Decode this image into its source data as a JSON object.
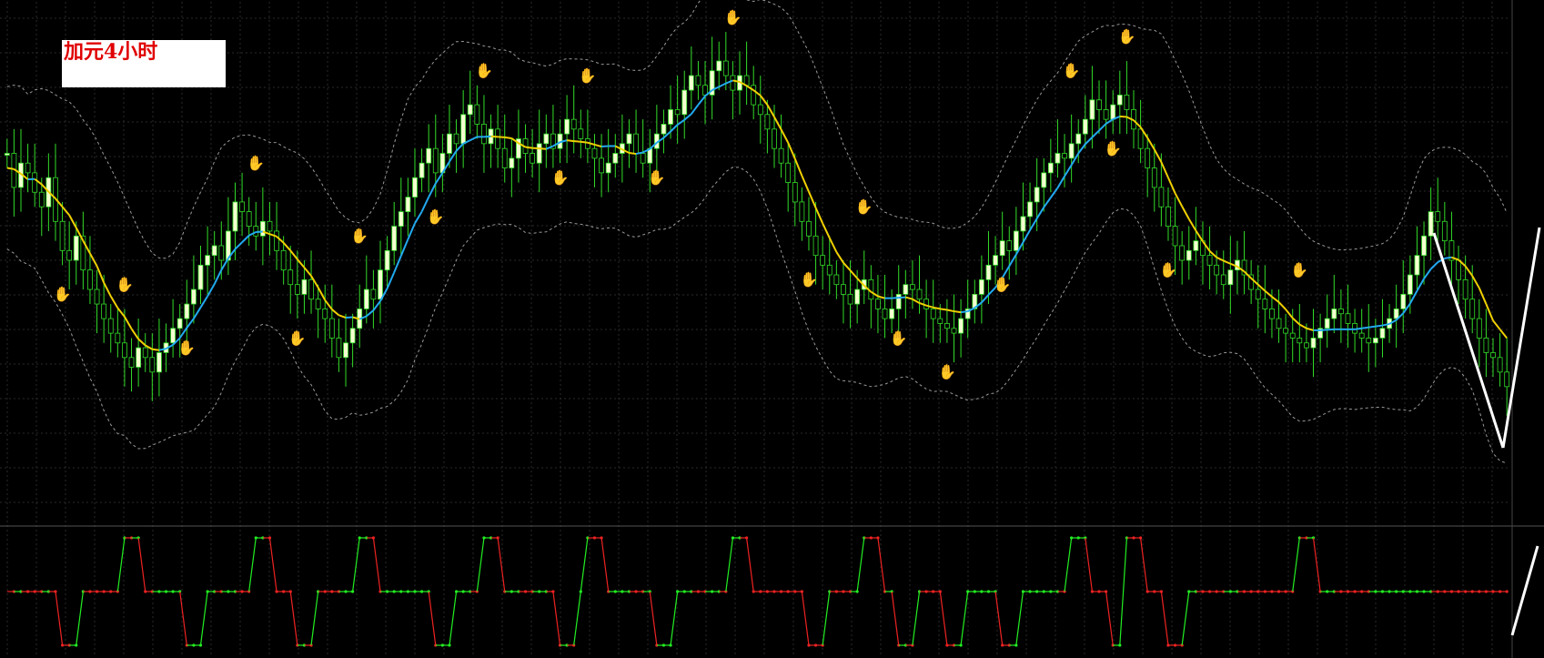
{
  "chart_label": "加元4小时",
  "colors": {
    "background": "#000000",
    "candle_body": "#f4ffd0",
    "candle_wick": "#32dc28",
    "ma_up": "#22aaf0",
    "ma_down": "#f0d000",
    "band": "#9a9a9a",
    "grid": "#2a2a2a",
    "osc_up": "#22ee22",
    "osc_down": "#ee2222",
    "fractal_top": "#ee2222",
    "fractal_bottom": "#3399ff",
    "annotation": "#ffffff"
  },
  "chart_data": {
    "type": "candlestick",
    "grid": true,
    "ylim": [
      0,
      100
    ],
    "closes": [
      72,
      65,
      70,
      68,
      64,
      61,
      67,
      58,
      52,
      50,
      55,
      48,
      44,
      41,
      38,
      35,
      33,
      30,
      28,
      32,
      30,
      27,
      31,
      33,
      36,
      38,
      41,
      44,
      49,
      51,
      53,
      50,
      56,
      62,
      60,
      57,
      55,
      58,
      56,
      52,
      48,
      45,
      43,
      46,
      42,
      40,
      38,
      34,
      30,
      33,
      36,
      40,
      44,
      42,
      48,
      52,
      57,
      60,
      63,
      67,
      70,
      73,
      68,
      72,
      76,
      74,
      80,
      82,
      78,
      74,
      77,
      73,
      69,
      71,
      75,
      72,
      70,
      74,
      76,
      73,
      76,
      79,
      77,
      75,
      73,
      71,
      68,
      70,
      72,
      74,
      76,
      72,
      70,
      73,
      76,
      78,
      81,
      80,
      85,
      88,
      86,
      84,
      89,
      91,
      88,
      85,
      88,
      86,
      82,
      80,
      77,
      73,
      70,
      66,
      62,
      58,
      55,
      51,
      49,
      47,
      45,
      43,
      41,
      44,
      46,
      42,
      40,
      38,
      40,
      43,
      45,
      44,
      42,
      40,
      38,
      37,
      36,
      35,
      38,
      40,
      43,
      46,
      49,
      51,
      54,
      52,
      56,
      59,
      62,
      65,
      68,
      70,
      72,
      71,
      74,
      76,
      79,
      83,
      81,
      79,
      82,
      84,
      81,
      77,
      73,
      69,
      65,
      61,
      57,
      53,
      50,
      52,
      54,
      51,
      49,
      47,
      45,
      48,
      50,
      47,
      44,
      42,
      40,
      38,
      36,
      35,
      34,
      33,
      32,
      34,
      36,
      38,
      40,
      39,
      37,
      35,
      34,
      33,
      34,
      36,
      38,
      40,
      43,
      47,
      51,
      55,
      60,
      58,
      54,
      50,
      46,
      42,
      38,
      34,
      31,
      30,
      27,
      24
    ],
    "ma_color_switch": "slope",
    "fractal_tops": [
      17,
      36,
      51,
      69,
      84,
      105,
      124,
      154,
      162,
      187
    ],
    "fractal_bottoms": [
      8,
      26,
      42,
      62,
      80,
      94,
      116,
      129,
      136,
      144,
      160,
      168
    ]
  },
  "oscillator": {
    "type": "line",
    "levels": [
      0,
      1,
      2
    ]
  }
}
